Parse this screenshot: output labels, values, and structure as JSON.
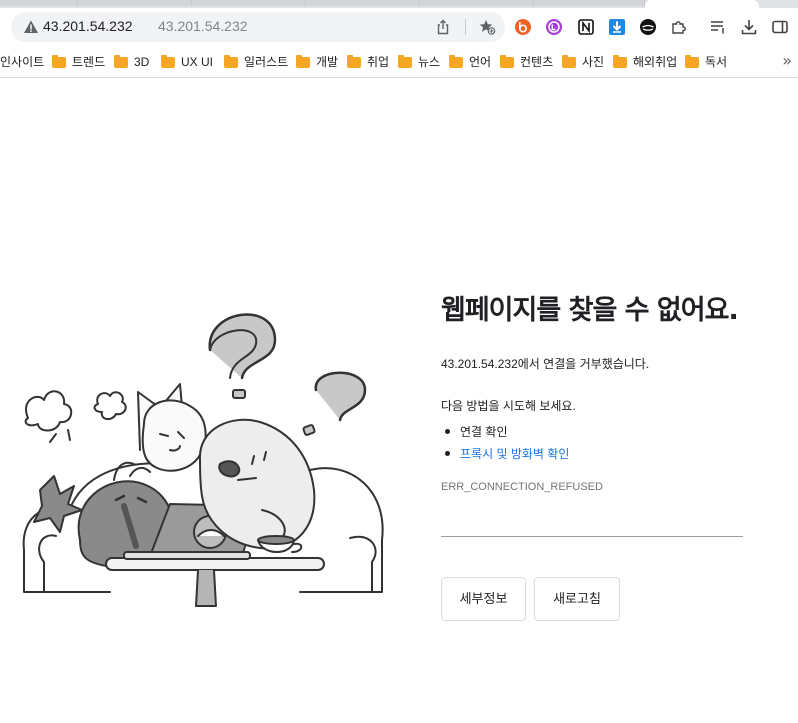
{
  "browser": {
    "address": {
      "host": "43.201.54.232",
      "host_secondary": "43.201.54.232"
    },
    "extensions": [
      "bitly-icon",
      "lastpass-icon",
      "notion-icon",
      "download-arrow-icon",
      "speaker-icon",
      "puzzle-icon",
      "reading-list-icon",
      "downloads-icon",
      "side-panel-icon"
    ],
    "bookmarks": [
      {
        "label": "인사이트",
        "folder": false
      },
      {
        "label": "트렌드",
        "folder": true
      },
      {
        "label": "3D",
        "folder": true
      },
      {
        "label": "UX UI",
        "folder": true
      },
      {
        "label": "일러스트",
        "folder": true
      },
      {
        "label": "개발",
        "folder": true
      },
      {
        "label": "취업",
        "folder": true
      },
      {
        "label": "뉴스",
        "folder": true
      },
      {
        "label": "언어",
        "folder": true
      },
      {
        "label": "컨텐츠",
        "folder": true
      },
      {
        "label": "사진",
        "folder": true
      },
      {
        "label": "해외취업",
        "folder": true
      },
      {
        "label": "독서",
        "folder": true
      }
    ],
    "more_label": "»"
  },
  "error_page": {
    "title": "웹페이지를 찾을 수 없어요.",
    "message": "43.201.54.232에서 연결을 거부했습니다.",
    "try_label": "다음 방법을 시도해 보세요.",
    "suggestions": [
      {
        "text": "연결 확인",
        "link": false
      },
      {
        "text": "프록시 및 방화벽 확인",
        "link": true
      }
    ],
    "error_code": "ERR_CONNECTION_REFUSED",
    "buttons": {
      "details": "세부정보",
      "reload": "새로고침"
    }
  },
  "colors": {
    "link": "#1a73e8",
    "folder": "#f5a623",
    "omnibox_bg": "#f1f3f4"
  }
}
